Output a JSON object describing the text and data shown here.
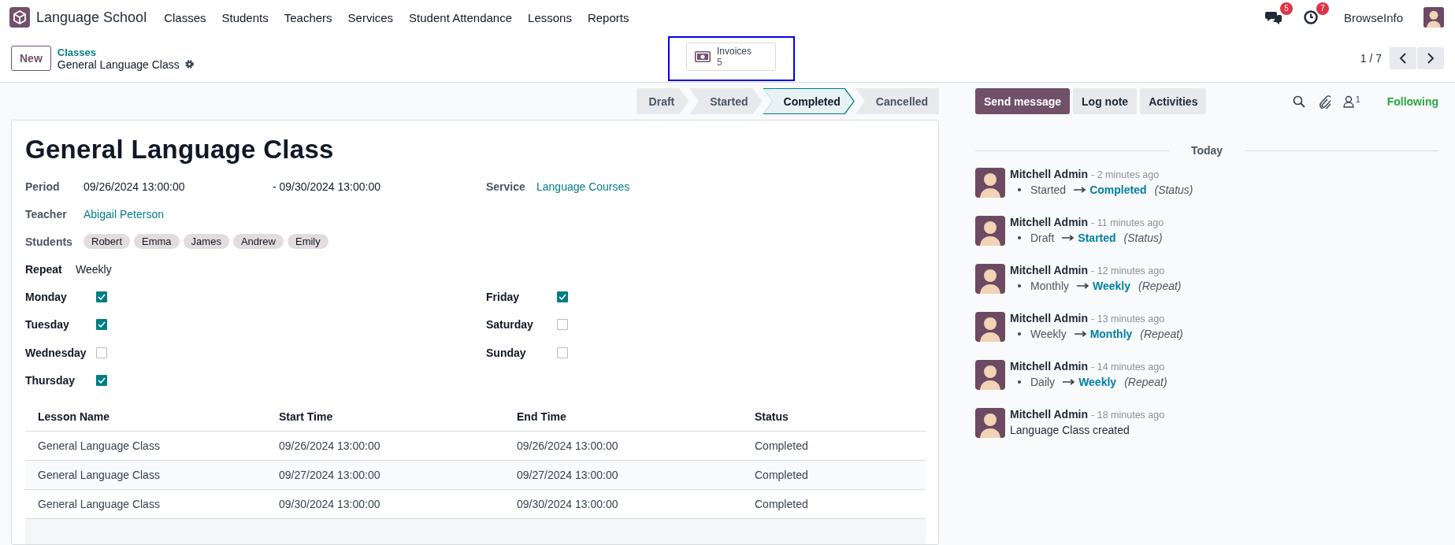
{
  "navbar": {
    "app_name": "Language School",
    "menu": [
      "Classes",
      "Students",
      "Teachers",
      "Services",
      "Student Attendance",
      "Lessons",
      "Reports"
    ],
    "messages_badge": "5",
    "activities_badge": "7",
    "company": "BrowseInfo"
  },
  "control_panel": {
    "new_button": "New",
    "breadcrumb": "Classes",
    "record_name": "General Language Class",
    "smart_button": {
      "label": "Invoices",
      "count": "5",
      "highlighted": true
    },
    "pager": "1 / 7"
  },
  "statusbar": [
    {
      "label": "Draft",
      "selected": false
    },
    {
      "label": "Started",
      "selected": false
    },
    {
      "label": "Completed",
      "selected": true
    },
    {
      "label": "Cancelled",
      "selected": false
    }
  ],
  "form": {
    "title": "General Language Class",
    "period": {
      "label": "Period",
      "start": "09/26/2024 13:00:00",
      "end": "- 09/30/2024 13:00:00"
    },
    "service": {
      "label": "Service",
      "value": "Language Courses"
    },
    "teacher": {
      "label": "Teacher",
      "value": "Abigail Peterson"
    },
    "students": {
      "label": "Students",
      "tags": [
        "Robert",
        "Emma",
        "James",
        "Andrew",
        "Emily"
      ]
    },
    "repeat": {
      "label": "Repeat",
      "value": "Weekly"
    },
    "days_column_1": [
      {
        "label": "Monday",
        "checked": true
      },
      {
        "label": "Tuesday",
        "checked": true
      },
      {
        "label": "Wednesday",
        "checked": false
      },
      {
        "label": "Thursday",
        "checked": true
      }
    ],
    "days_column_2": [
      {
        "label": "Friday",
        "checked": true
      },
      {
        "label": "Saturday",
        "checked": false
      },
      {
        "label": "Sunday",
        "checked": false
      }
    ],
    "lessons": {
      "columns": [
        "Lesson Name",
        "Start Time",
        "End Time",
        "Status"
      ],
      "rows": [
        [
          "General Language Class",
          "09/26/2024 13:00:00",
          "09/26/2024 13:00:00",
          "Completed"
        ],
        [
          "General Language Class",
          "09/27/2024 13:00:00",
          "09/27/2024 13:00:00",
          "Completed"
        ],
        [
          "General Language Class",
          "09/30/2024 13:00:00",
          "09/30/2024 13:00:00",
          "Completed"
        ]
      ]
    }
  },
  "chatter": {
    "buttons": [
      {
        "label": "Send message",
        "kind": "primary"
      },
      {
        "label": "Log note",
        "kind": "secondary"
      },
      {
        "label": "Activities",
        "kind": "secondary"
      }
    ],
    "followers_count": "1",
    "follow_status": "Following",
    "date_separator": "Today",
    "messages": [
      {
        "author": "Mitchell Admin",
        "time": "- 2 minutes ago",
        "kind": "tracking",
        "old_value": "Started",
        "new_value": "Completed",
        "field": "(Status)"
      },
      {
        "author": "Mitchell Admin",
        "time": "- 11 minutes ago",
        "kind": "tracking",
        "old_value": "Draft",
        "new_value": "Started",
        "field": "(Status)"
      },
      {
        "author": "Mitchell Admin",
        "time": "- 12 minutes ago",
        "kind": "tracking",
        "old_value": "Monthly",
        "new_value": "Weekly",
        "field": "(Repeat)"
      },
      {
        "author": "Mitchell Admin",
        "time": "- 13 minutes ago",
        "kind": "tracking",
        "old_value": "Weekly",
        "new_value": "Monthly",
        "field": "(Repeat)"
      },
      {
        "author": "Mitchell Admin",
        "time": "- 14 minutes ago",
        "kind": "tracking",
        "old_value": "Daily",
        "new_value": "Weekly",
        "field": "(Repeat)"
      },
      {
        "author": "Mitchell Admin",
        "time": "- 18 minutes ago",
        "kind": "note",
        "body": "Language Class created"
      }
    ]
  }
}
